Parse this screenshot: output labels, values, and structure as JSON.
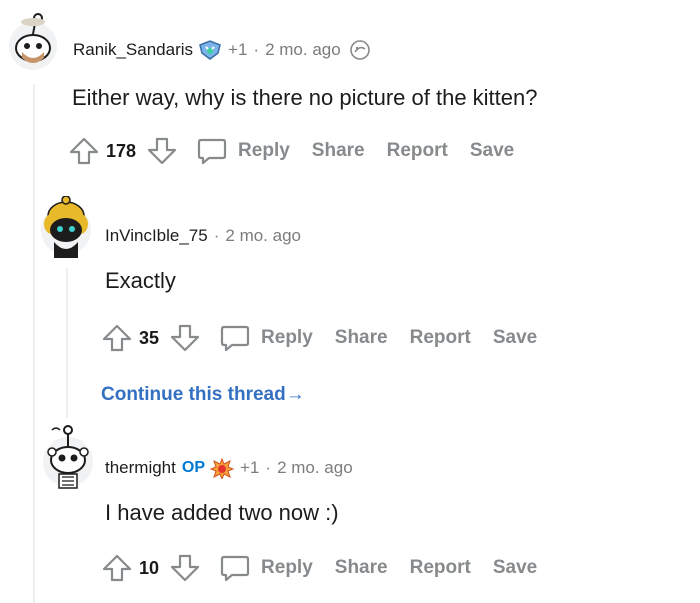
{
  "comments": [
    {
      "author": "Ranik_Sandaris",
      "award_count": "+1",
      "separator": "·",
      "time": "2 mo. ago",
      "body": "Either way, why is there no picture of the kitten?",
      "score": "178",
      "actions": {
        "reply": "Reply",
        "share": "Share",
        "report": "Report",
        "save": "Save"
      }
    },
    {
      "author": "InVincIble_75",
      "separator": "·",
      "time": "2 mo. ago",
      "body": "Exactly",
      "score": "35",
      "actions": {
        "reply": "Reply",
        "share": "Share",
        "report": "Report",
        "save": "Save"
      }
    },
    {
      "author": "thermight",
      "op_label": "OP",
      "award_count": "+1",
      "separator": "·",
      "time": "2 mo. ago",
      "body": "I have added two now :)",
      "score": "10",
      "actions": {
        "reply": "Reply",
        "share": "Share",
        "report": "Report",
        "save": "Save"
      }
    }
  ],
  "continue_thread": {
    "label": "Continue this thread",
    "arrow": "→"
  },
  "colors": {
    "link": "#3470c2",
    "op": "#0079d3",
    "muted": "#878a8c",
    "text": "#1c1c1c",
    "thread_line": "#edeff1"
  }
}
